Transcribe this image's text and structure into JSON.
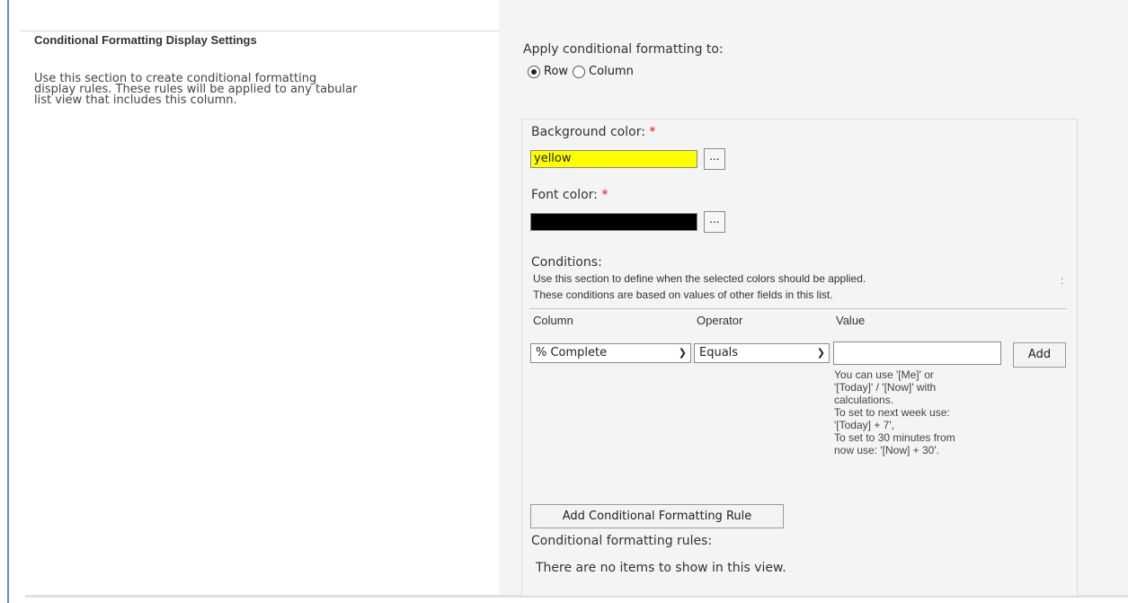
{
  "section": {
    "title": "Conditional Formatting Display Settings",
    "description": "Use this section to create conditional formatting display rules. These rules will be applied to any tabular list view that includes this column."
  },
  "apply": {
    "label": "Apply conditional formatting to:",
    "options": [
      {
        "label": "Row",
        "selected": true
      },
      {
        "label": "Column",
        "selected": false
      }
    ]
  },
  "background_color": {
    "label": "Background color:",
    "required_marker": "*",
    "value": "yellow",
    "swatch": "#ffff00",
    "picker_label": "..."
  },
  "font_color": {
    "label": "Font color:",
    "required_marker": "*",
    "value": "",
    "swatch": "#000000",
    "picker_label": "..."
  },
  "conditions": {
    "label": "Conditions:",
    "hint_line1": "Use this section to define when the selected colors should be applied.",
    "hint_line2": "These conditions are based on values of other fields in this list.",
    "side_mark": ":",
    "columns": [
      "Column",
      "Operator",
      "Value"
    ],
    "column_value": "% Complete",
    "operator_value": "Equals",
    "value_text": "",
    "add_label": "Add",
    "value_hint": [
      "You can use '[Me]' or",
      "'[Today]' / '[Now]' with",
      "calculations.",
      "To set to next week use:",
      "'[Today] + 7',",
      "To set to 30 minutes from",
      "now use: '[Now] + 30'."
    ]
  },
  "add_rule_label": "Add Conditional Formatting Rule",
  "rules": {
    "label": "Conditional formatting rules:",
    "empty_text": "There are no items to show in this view."
  },
  "colors": {
    "border_accent": "#6e8fb8",
    "required": "#dd1111",
    "panel_bg": "#f4f4f4"
  }
}
